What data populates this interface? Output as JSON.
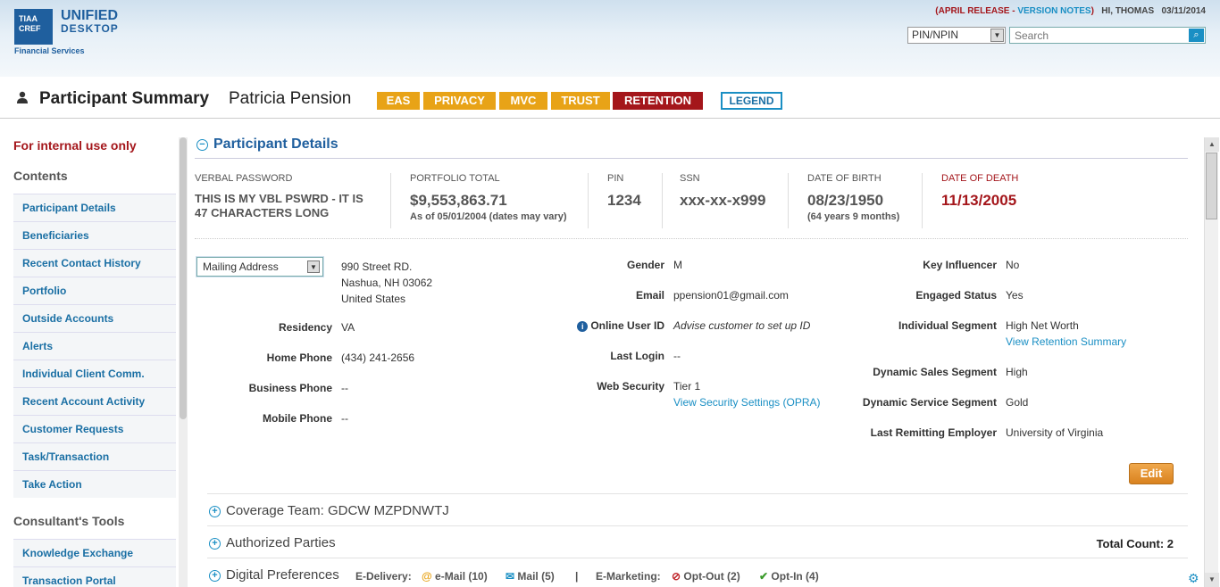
{
  "header": {
    "logo_top": "TIAA",
    "logo_bottom": "CREF",
    "title_line1": "UNIFIED",
    "title_line2": "DESKTOP",
    "subtitle": "Financial Services",
    "release_prefix": "(APRIL RELEASE - ",
    "version_notes": "VERSION NOTES",
    "release_suffix": ")",
    "greeting": "HI, THOMAS",
    "date": "03/11/2014",
    "pin_select": "PIN/NPIN",
    "search_placeholder": "Search"
  },
  "titlebar": {
    "title": "Participant Summary",
    "name": "Patricia Pension",
    "tags": [
      "EAS",
      "PRIVACY",
      "MVC",
      "TRUST",
      "RETENTION"
    ],
    "legend": "LEGEND"
  },
  "leftnav": {
    "internal": "For internal use only",
    "contents_heading": "Contents",
    "items": [
      "Participant Details",
      "Beneficiaries",
      "Recent Contact History",
      "Portfolio",
      "Outside Accounts",
      "Alerts",
      "Individual Client Comm.",
      "Recent Account Activity",
      "Customer Requests",
      "Task/Transaction",
      "Take Action"
    ],
    "tools_heading": "Consultant's Tools",
    "tools": [
      "Knowledge Exchange",
      "Transaction Portal"
    ]
  },
  "details": {
    "section_title": "Participant Details",
    "verbal_password_label": "VERBAL PASSWORD",
    "verbal_password_l1": "THIS IS MY VBL PSWRD - IT IS",
    "verbal_password_l2": "47 CHARACTERS LONG",
    "portfolio_label": "PORTFOLIO TOTAL",
    "portfolio_value": "$9,553,863.71",
    "portfolio_note": "As of 05/01/2004 (dates may vary)",
    "pin_label": "PIN",
    "pin_value": "1234",
    "ssn_label": "SSN",
    "ssn_value": "xxx-xx-x999",
    "dob_label": "DATE OF BIRTH",
    "dob_value": "08/23/1950",
    "dob_note": "(64 years 9 months)",
    "dod_label": "DATE OF DEATH",
    "dod_value": "11/13/2005",
    "address_type": "Mailing Address",
    "address_l1": "990 Street RD.",
    "address_l2": "Nashua, NH 03062",
    "address_l3": "United States",
    "residency_label": "Residency",
    "residency": "VA",
    "home_phone_label": "Home Phone",
    "home_phone": "(434) 241-2656",
    "business_phone_label": "Business Phone",
    "business_phone": "--",
    "mobile_phone_label": "Mobile Phone",
    "mobile_phone": "--",
    "gender_label": "Gender",
    "gender": "M",
    "email_label": "Email",
    "email": "ppension01@gmail.com",
    "online_id_label": "Online User ID",
    "online_id": "Advise customer to set up ID",
    "last_login_label": "Last Login",
    "last_login": "--",
    "web_security_label": "Web Security",
    "web_security": "Tier 1",
    "web_security_link": "View Security Settings (OPRA)",
    "key_influencer_label": "Key Influencer",
    "key_influencer": "No",
    "engaged_label": "Engaged Status",
    "engaged": "Yes",
    "segment_label": "Individual Segment",
    "segment": "High Net Worth",
    "retention_link": "View Retention Summary",
    "dyn_sales_label": "Dynamic Sales Segment",
    "dyn_sales": "High",
    "dyn_service_label": "Dynamic Service Segment",
    "dyn_service": "Gold",
    "employer_label": "Last Remitting Employer",
    "employer": "University of Virginia",
    "edit": "Edit"
  },
  "sections": {
    "coverage": "Coverage Team: GDCW MZPDNWTJ",
    "authorized": "Authorized Parties",
    "total_count": "Total Count: 2",
    "digital": "Digital Preferences",
    "edelivery_label": "E-Delivery:",
    "email_pref": "e-Mail (10)",
    "mail_pref": "Mail (5)",
    "divider": "|",
    "emarketing_label": "E-Marketing:",
    "optout": "Opt-Out (2)",
    "optin": "Opt-In (4)"
  },
  "colors": {
    "brand_blue": "#1f5f9e",
    "link_blue": "#1a8fc4",
    "alert_red": "#a4161b",
    "tag_gold": "#e8a317",
    "edit_orange": "#e08e2b"
  }
}
